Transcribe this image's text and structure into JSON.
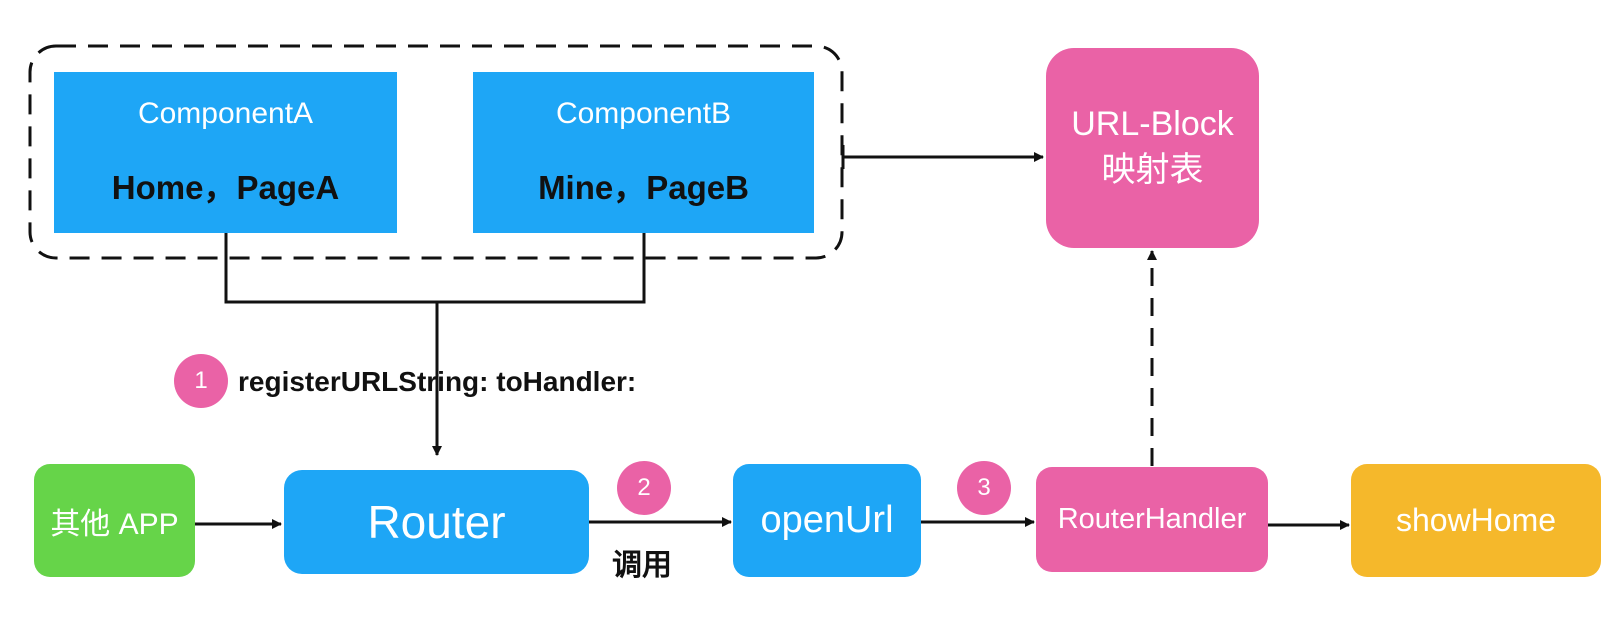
{
  "componentA": {
    "title": "ComponentA",
    "pages": "Home，PageA"
  },
  "componentB": {
    "title": "ComponentB",
    "pages": "Mine，PageB"
  },
  "other_app": {
    "label": "其他 APP"
  },
  "router": {
    "label": "Router"
  },
  "open_url": {
    "label": "openUrl"
  },
  "router_handler": {
    "label": "RouterHandler"
  },
  "show_home": {
    "label": "showHome"
  },
  "url_block": {
    "line1": "URL-Block",
    "line2": "映射表"
  },
  "steps": {
    "one": "1",
    "two": "2",
    "three": "3"
  },
  "labels": {
    "register": "registerURLString: toHandler:",
    "call": "调用"
  },
  "colors": {
    "blue": "#1ea6f6",
    "pink": "#ea62a6",
    "green": "#66d449",
    "orange": "#f5b82b",
    "line": "#111111"
  }
}
